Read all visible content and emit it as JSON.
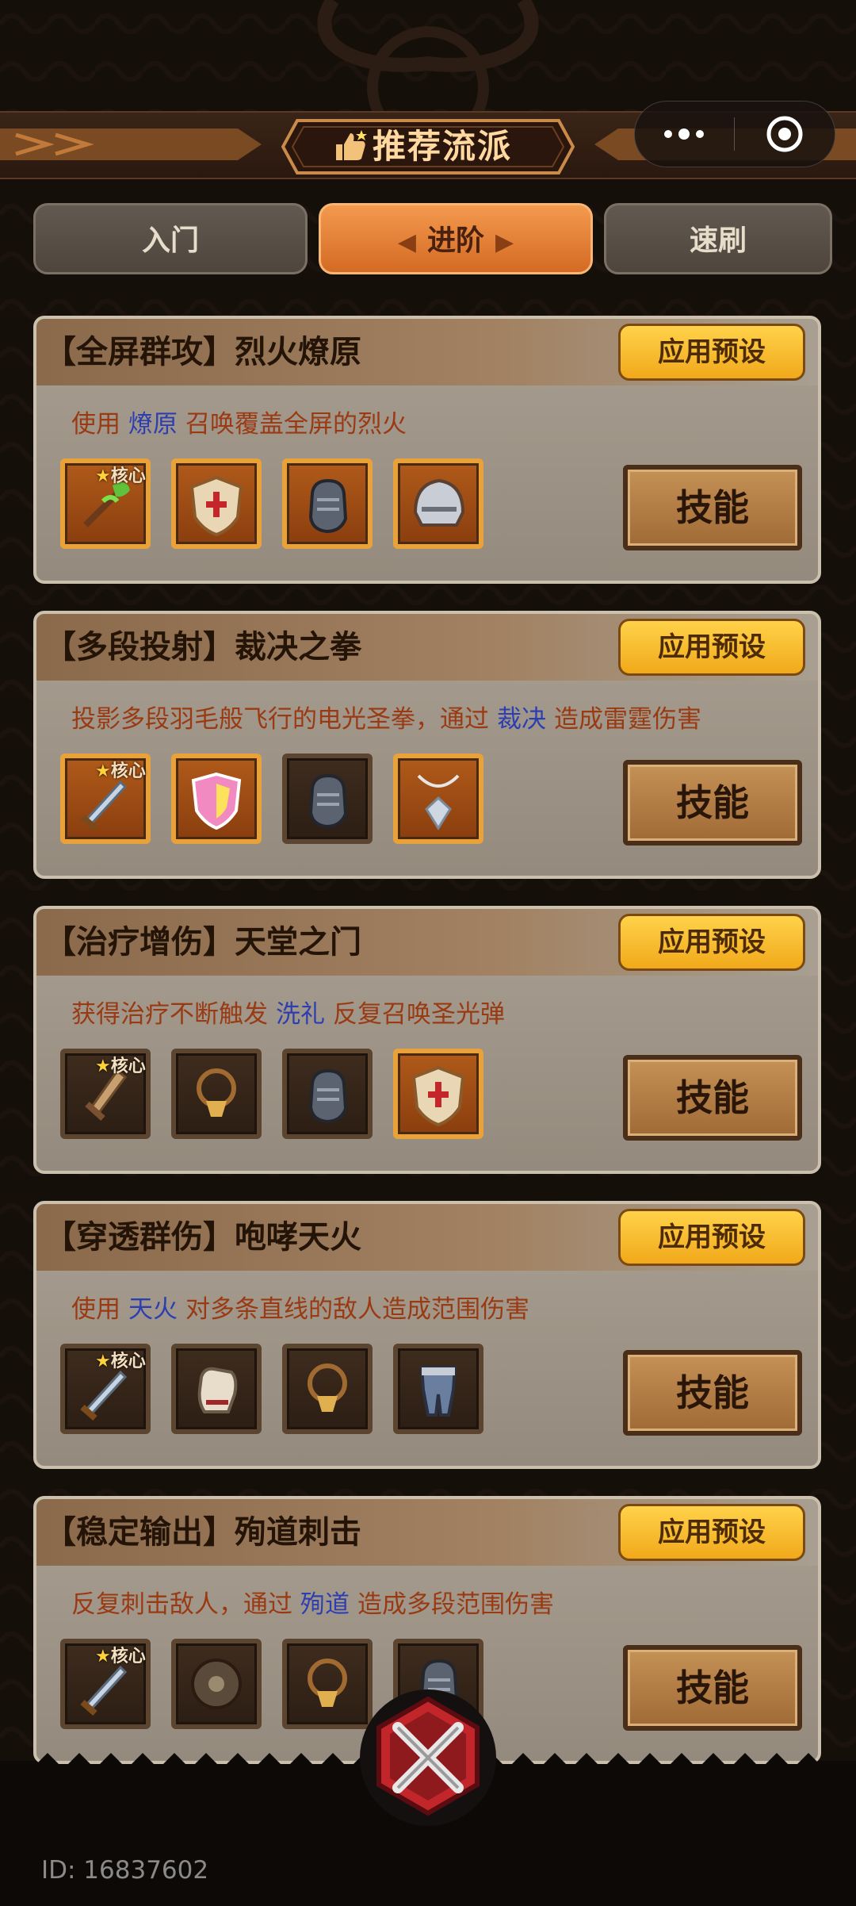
{
  "header": {
    "title": "推荐流派",
    "title_icon": "thumbs-up-icon"
  },
  "capsule": {
    "more_icon": "more-dots-icon",
    "close_icon": "target-close-icon"
  },
  "tabs": [
    {
      "label": "入门",
      "active": false
    },
    {
      "label": "进阶",
      "active": true
    },
    {
      "label": "速刷",
      "active": false
    }
  ],
  "cards": [
    {
      "title": "【全屏群攻】烈火燎原",
      "apply_label": "应用预设",
      "desc_pre": "使用",
      "desc_kw": "燎原",
      "desc_post": "召唤覆盖全屏的烈火",
      "core_label": "核心",
      "items": [
        "green-scepter-icon",
        "cross-shield-icon",
        "gauntlet-icon",
        "helmet-icon"
      ],
      "items_lit": [
        true,
        true,
        true,
        true
      ],
      "skill_label": "技能"
    },
    {
      "title": "【多段投射】裁决之拳",
      "apply_label": "应用预设",
      "desc_pre": "投影多段羽毛般飞行的电光圣拳，通过",
      "desc_kw": "裁决",
      "desc_post": "造成雷霆伤害",
      "core_label": "核心",
      "items": [
        "dagger-icon",
        "pink-shield-icon",
        "gauntlet-icon",
        "pendant-icon"
      ],
      "items_lit": [
        true,
        true,
        false,
        true
      ],
      "skill_label": "技能"
    },
    {
      "title": "【治疗增伤】天堂之门",
      "apply_label": "应用预设",
      "desc_pre": "获得治疗不断触发",
      "desc_kw": "洗礼",
      "desc_post": "反复召唤圣光弹",
      "core_label": "核心",
      "items": [
        "sword-icon",
        "amulet-icon",
        "gauntlet-icon",
        "cross-shield-icon"
      ],
      "items_lit": [
        false,
        false,
        false,
        true
      ],
      "skill_label": "技能"
    },
    {
      "title": "【穿透群伤】咆哮天火",
      "apply_label": "应用预设",
      "desc_pre": "使用",
      "desc_kw": "天火",
      "desc_post": "对多条直线的敌人造成范围伤害",
      "core_label": "核心",
      "items": [
        "dagger-icon",
        "glove-icon",
        "amulet-icon",
        "leg-armor-icon"
      ],
      "items_lit": [
        false,
        false,
        false,
        false
      ],
      "skill_label": "技能"
    },
    {
      "title": "【稳定输出】殉道刺击",
      "apply_label": "应用预设",
      "desc_pre": "反复刺击敌人，通过",
      "desc_kw": "殉道",
      "desc_post": "造成多段范围伤害",
      "core_label": "核心",
      "items": [
        "dagger-icon",
        "round-shield-icon",
        "amulet-icon",
        "gauntlet-icon"
      ],
      "items_lit": [
        false,
        false,
        false,
        false
      ],
      "skill_label": "技能"
    }
  ],
  "footer": {
    "id_text": "ID: 16837602",
    "emblem_icon": "crossed-swords-emblem-icon"
  },
  "colors": {
    "accent": "#e07a30",
    "keyword": "#2d3fb0",
    "desc": "#9a3a12",
    "apply_bg": "#f6be32"
  }
}
